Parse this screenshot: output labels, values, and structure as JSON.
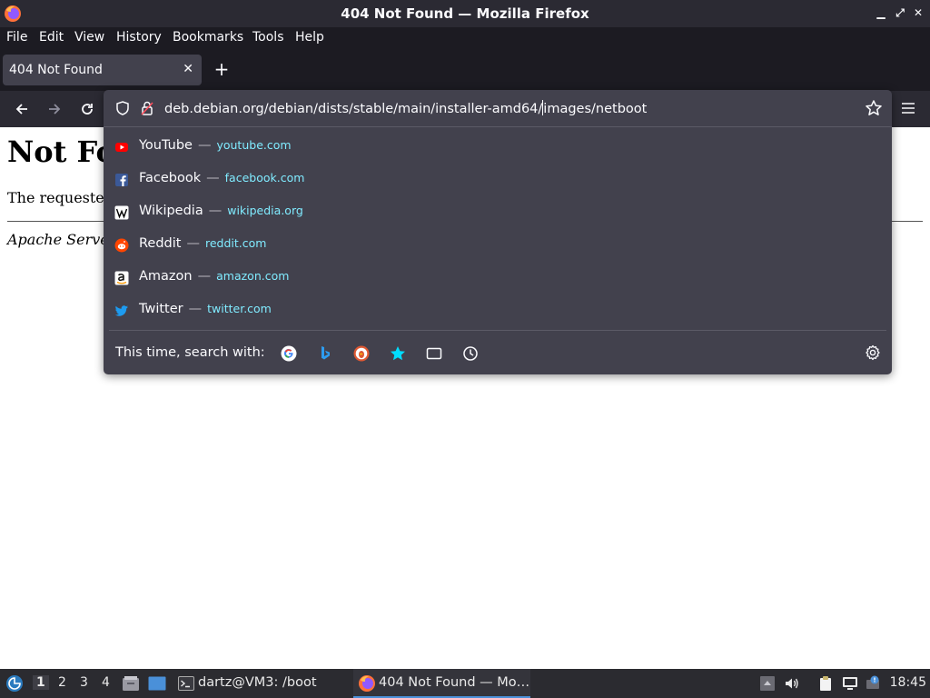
{
  "window": {
    "title": "404 Not Found — Mozilla Firefox",
    "controls": [
      "minimize-icon",
      "maximize-icon",
      "close-icon"
    ]
  },
  "menubar": {
    "items": [
      {
        "label": "File"
      },
      {
        "label": "Edit"
      },
      {
        "label": "View"
      },
      {
        "label": "History"
      },
      {
        "label": "Bookmarks"
      },
      {
        "label": "Tools"
      },
      {
        "label": "Help"
      }
    ]
  },
  "tabs": [
    {
      "title": "404 Not Found",
      "close": "✕",
      "active": true
    }
  ],
  "newtab_label": "+",
  "urlbar": {
    "url_before_caret": "deb.debian.org/debian/dists/stable/main/installer-amd64/",
    "url_after_caret": "images/netboot"
  },
  "suggestions": [
    {
      "name": "YouTube",
      "site": "youtube.com",
      "icon": "youtube-icon"
    },
    {
      "name": "Facebook",
      "site": "facebook.com",
      "icon": "facebook-icon"
    },
    {
      "name": "Wikipedia",
      "site": "wikipedia.org",
      "icon": "wikipedia-icon"
    },
    {
      "name": "Reddit",
      "site": "reddit.com",
      "icon": "reddit-icon"
    },
    {
      "name": "Amazon",
      "site": "amazon.com",
      "icon": "amazon-icon"
    },
    {
      "name": "Twitter",
      "site": "twitter.com",
      "icon": "twitter-icon"
    }
  ],
  "suggestion_dash": "—",
  "search_with": {
    "label": "This time, search with:",
    "engines": [
      "google-icon",
      "bing-icon",
      "duckduckgo-icon",
      "bookmarks-icon",
      "tabs-icon",
      "history-icon"
    ]
  },
  "page": {
    "heading": "Not Fo",
    "paragraph": "The requeste",
    "address": "Apache Serve"
  },
  "taskbar": {
    "workspaces": [
      "1",
      "2",
      "3",
      "4"
    ],
    "active_workspace": "1",
    "tasks": [
      {
        "label": "dartz@VM3: /boot",
        "icon": "terminal-icon"
      },
      {
        "label": "404 Not Found — Mo…",
        "icon": "firefox-icon",
        "active": true
      }
    ],
    "clock": "18:45"
  },
  "colors": {
    "toolbar": "#2b2a33",
    "tabstrip": "#1c1b22",
    "panel": "#42414d",
    "url_site": "#80ebff",
    "taskbar": "#2b2b30"
  }
}
